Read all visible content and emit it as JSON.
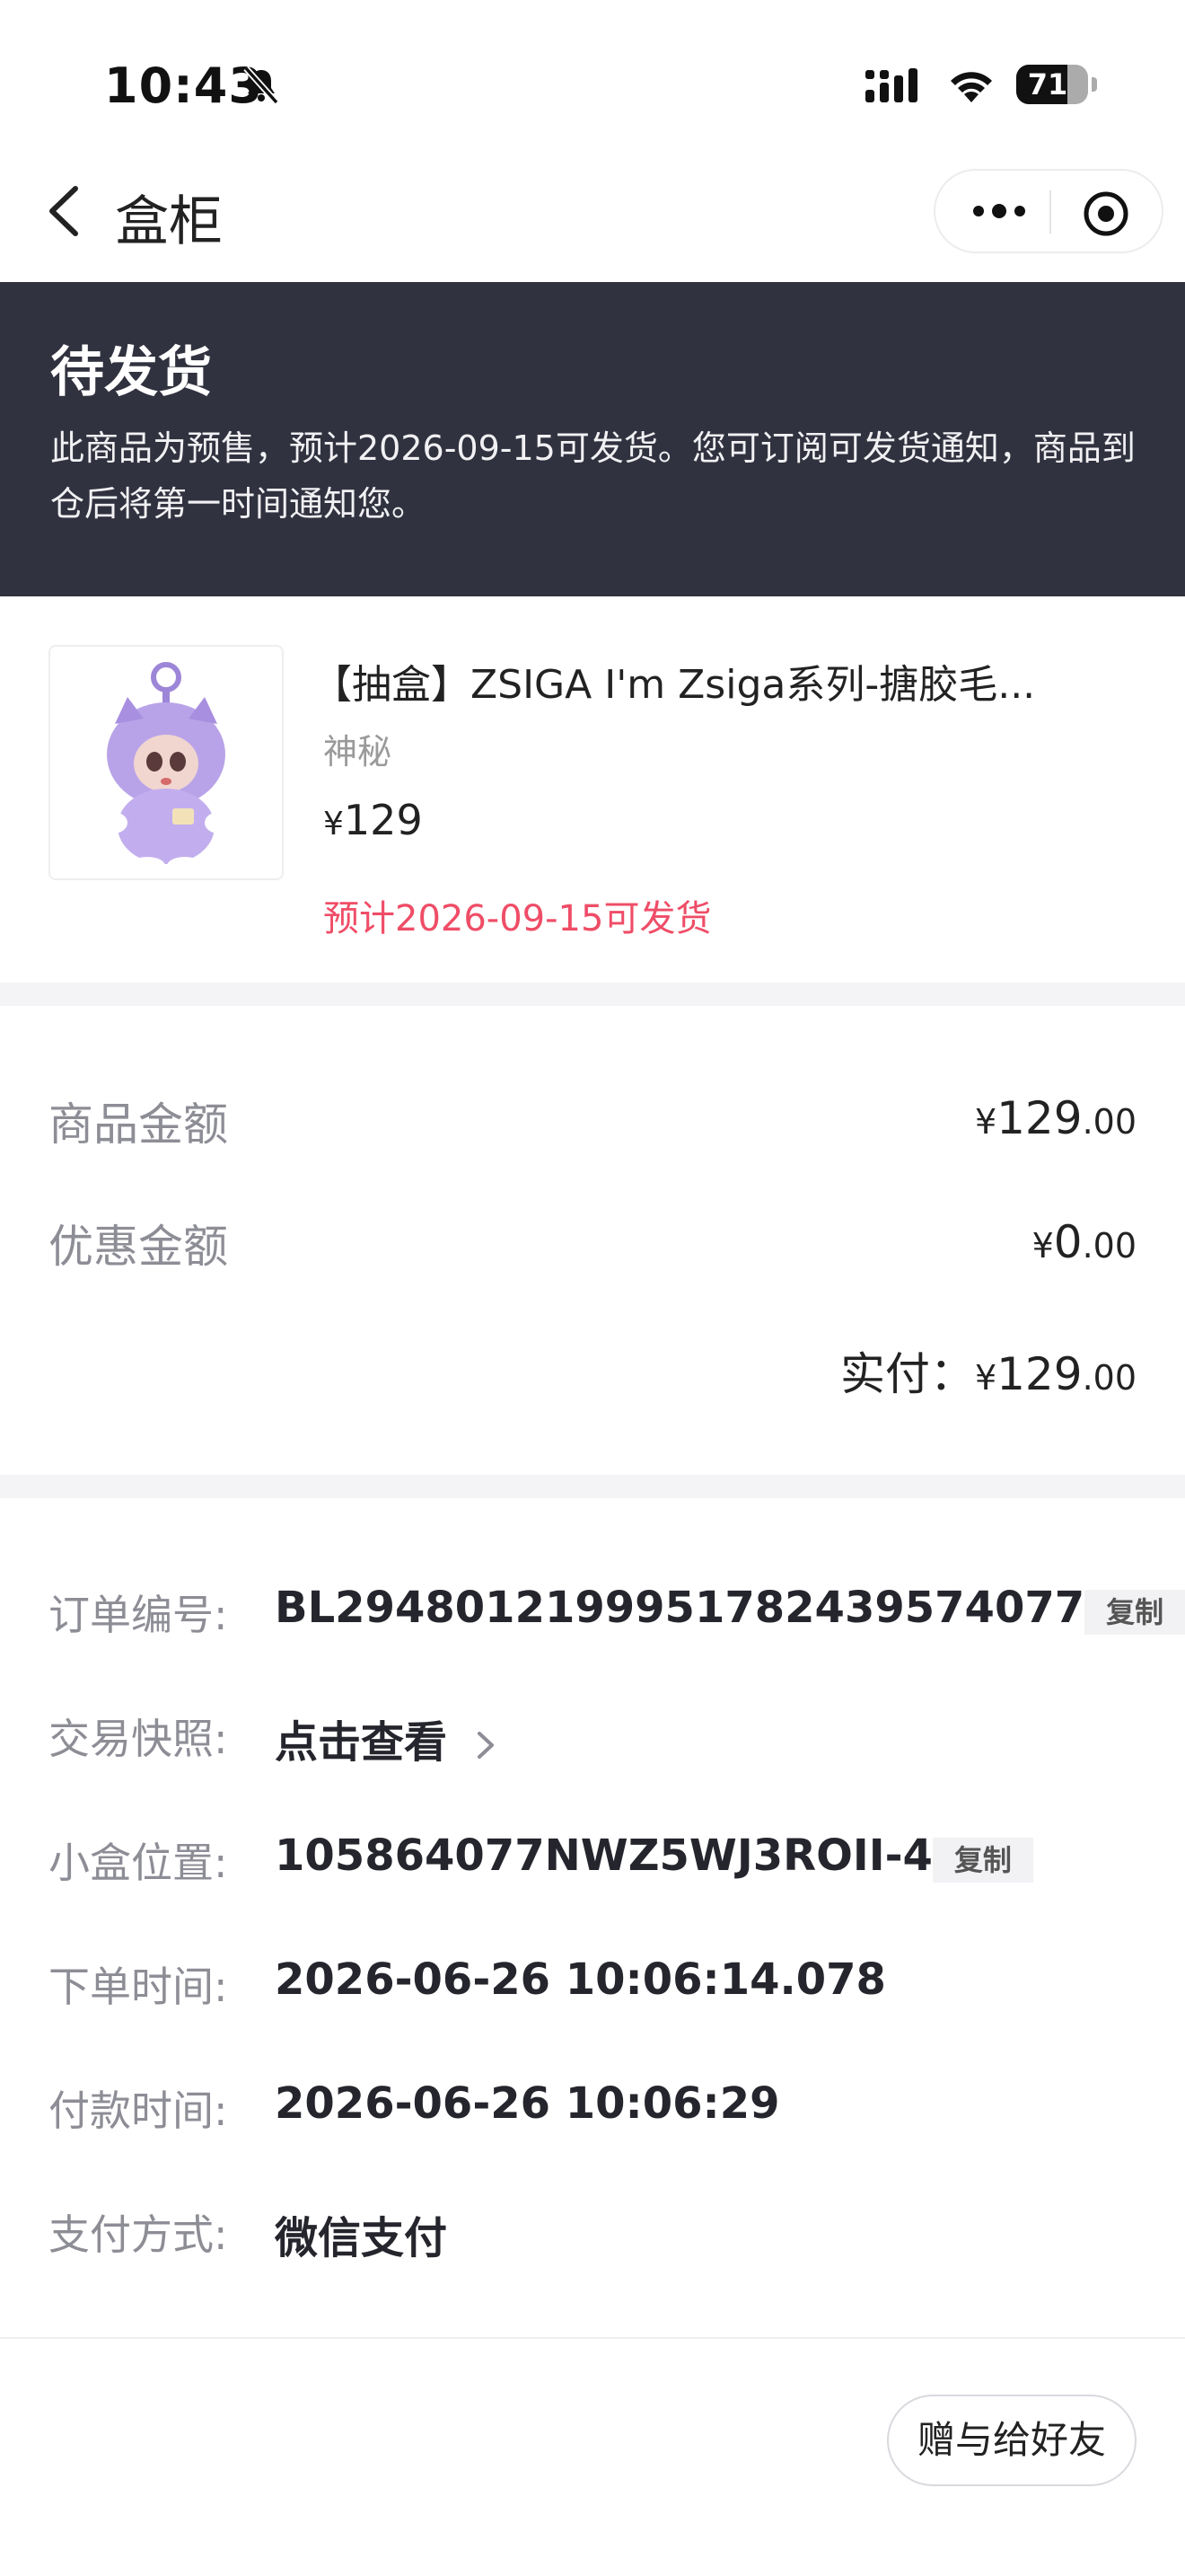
{
  "status_bar": {
    "time": "10:43",
    "battery": "71",
    "battery_level": 0.71
  },
  "nav": {
    "back_icon": "chevron-left-icon",
    "title": "盒柜",
    "more_icon": "more-dots-icon",
    "target_icon": "target-icon"
  },
  "banner": {
    "title": "待发货",
    "description": "此商品为预售，预计2026-09-15可发货。您可订阅可发货通知，商品到仓后将第一时间通知您。"
  },
  "product": {
    "name": "【抽盒】ZSIGA I'm Zsiga系列-搪胶毛...",
    "subtitle": "神秘",
    "currency": "¥",
    "price": "129",
    "ship_note": "预计2026-09-15可发货",
    "image_icon": "purple-plush-figure"
  },
  "amounts": {
    "goods_label": "商品金额",
    "goods_int": "129",
    "goods_dec": ".00",
    "discount_label": "优惠金额",
    "discount_int": "0",
    "discount_dec": ".00",
    "paid_label": "实付：",
    "paid_int": "129",
    "paid_dec": ".00",
    "currency": "¥"
  },
  "order_info": {
    "order_no_label": "订单编号:",
    "order_no": "BL29480121999517824395740​77",
    "copy_label": "复制",
    "snapshot_label": "交易快照:",
    "snapshot_value": "点击查看",
    "box_pos_label": "小盒位置:",
    "box_pos": "105864077NWZ5WJ3ROII-4",
    "order_time_label": "下单时间:",
    "order_time": "2026-06-26 10:06:14.078",
    "pay_time_label": "付款时间:",
    "pay_time": "2026-06-26 10:06:29",
    "pay_method_label": "支付方式:",
    "pay_method": "微信支付"
  },
  "footer": {
    "gift_button": "赠与给好友"
  },
  "colors": {
    "banner_bg": "#31323f",
    "ship_note": "#ef4d67",
    "separator": "#f4f4f7"
  }
}
